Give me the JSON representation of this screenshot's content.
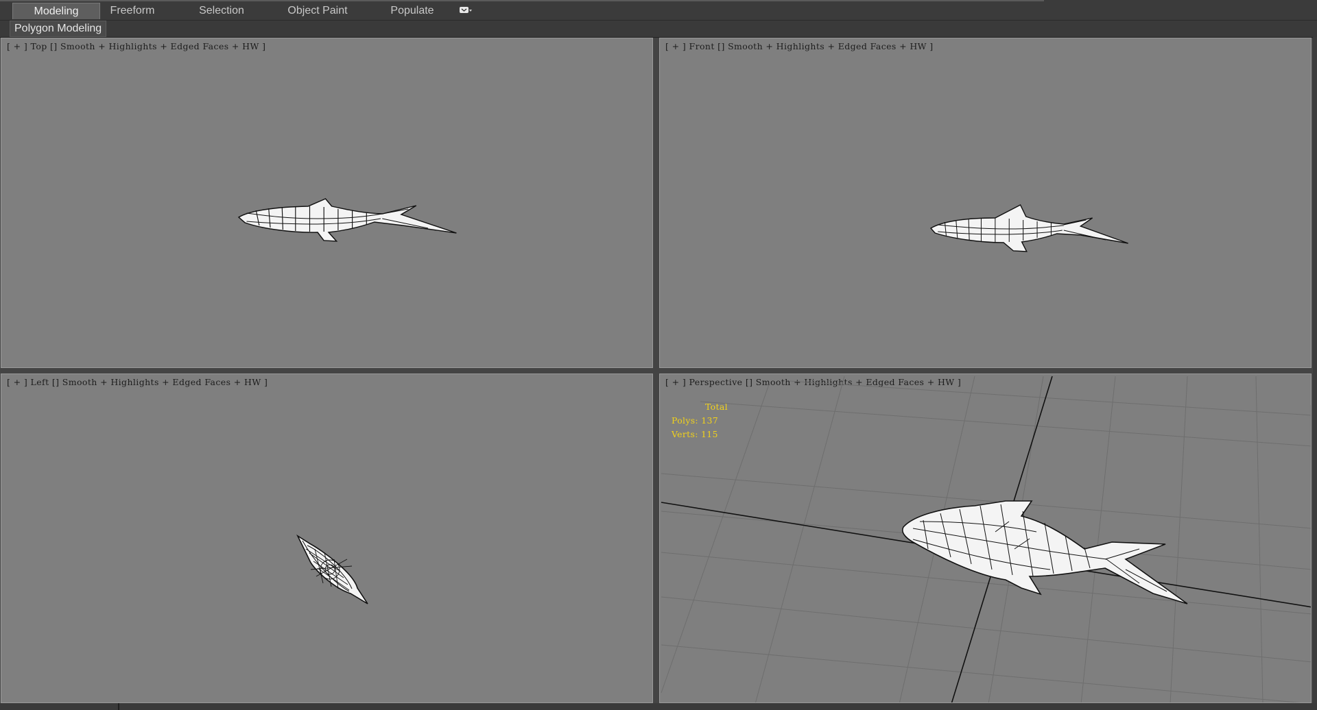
{
  "ribbon": {
    "tabs": [
      {
        "label": "Modeling",
        "active": true
      },
      {
        "label": "Freeform",
        "active": false
      },
      {
        "label": "Selection",
        "active": false
      },
      {
        "label": "Object Paint",
        "active": false
      },
      {
        "label": "Populate",
        "active": false
      }
    ],
    "extra_icon": "ribbon-options-icon",
    "panel_label": "Polygon Modeling"
  },
  "viewports": {
    "top": {
      "label": "[ + ] Top [] Smooth + Highlights + Edged Faces + HW ]"
    },
    "front": {
      "label": "[ + ] Front [] Smooth + Highlights + Edged Faces + HW ]"
    },
    "left": {
      "label": "[ + ] Left [] Smooth + Highlights + Edged Faces + HW ]"
    },
    "perspective": {
      "label": "[ + ] Perspective [] Smooth + Highlights + Edged Faces + HW ]",
      "stats": {
        "title": "Total",
        "polys": "Polys: 137",
        "verts": "Verts: 115"
      }
    }
  },
  "colors": {
    "viewport_bg": "#7f7f7f",
    "stats_text": "#f2d21a",
    "mesh_fill": "#f4f4f4",
    "mesh_edge": "#111111"
  }
}
